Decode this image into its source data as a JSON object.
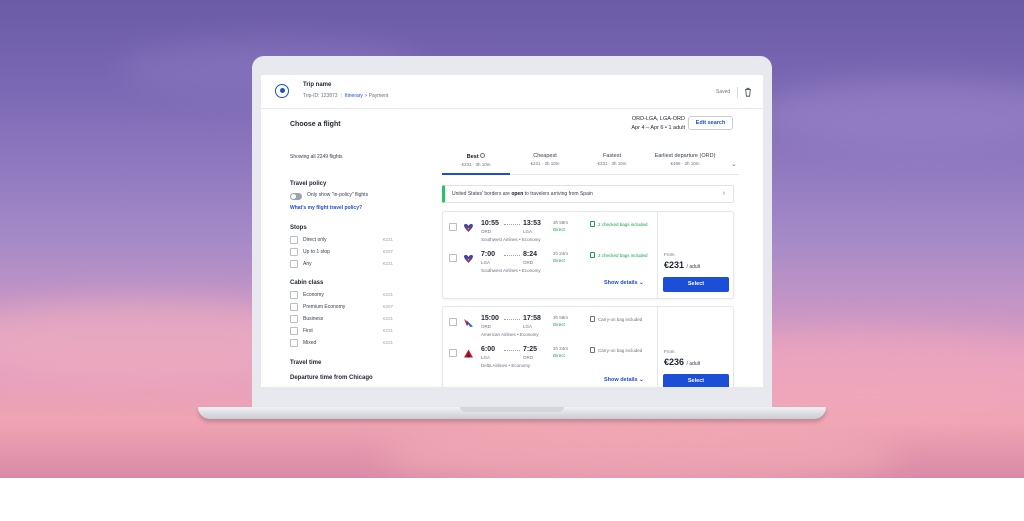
{
  "header": {
    "trip_name": "Trip name",
    "trip_id": "Trip-ID: 123873",
    "breadcrumb_itinerary": "Itinerary",
    "breadcrumb_sep": ">",
    "breadcrumb_payment": "Payment",
    "saved": "Saved"
  },
  "search": {
    "title": "Choose a flight",
    "route": "ORD-LGA, LGA-ORD",
    "dates": "Apr 4 – Apr 6 • 1 adult",
    "edit_label": "Edit search",
    "showing": "Showing all 2249 flights"
  },
  "tabs": [
    {
      "label": "Best",
      "sub": "€231 · 3h 10m"
    },
    {
      "label": "Cheapest",
      "sub": "€231 · 3h 10m"
    },
    {
      "label": "Fastest",
      "sub": "€231 · 3h 10m"
    },
    {
      "label": "Earliest departure (ORD)",
      "sub": "€496 · 3h 10m"
    }
  ],
  "notice": {
    "prefix": "United States' borders are ",
    "bold": "open",
    "suffix": " to travelers arriving from Spain"
  },
  "sidebar": {
    "policy_title": "Travel policy",
    "policy_toggle": "Only show \"in-policy\" flights",
    "policy_link": "What's my flight travel policy?",
    "stops_title": "Stops",
    "stops": [
      {
        "label": "Direct only",
        "price": "€231"
      },
      {
        "label": "Up to 1 stop",
        "price": "€207"
      },
      {
        "label": "Any",
        "price": "€231"
      }
    ],
    "cabin_title": "Cabin class",
    "cabin": [
      {
        "label": "Economy",
        "price": "€231"
      },
      {
        "label": "Premium Economy",
        "price": "€207"
      },
      {
        "label": "Business",
        "price": "€231"
      },
      {
        "label": "First",
        "price": "€231"
      },
      {
        "label": "Mixed",
        "price": "€231"
      }
    ],
    "travel_time_title": "Travel time",
    "departure_title": "Departure time from Chicago"
  },
  "results": [
    {
      "legs": [
        {
          "dep": "10:55",
          "dep_ap": "ORD",
          "arr": "13:53",
          "arr_ap": "LGA",
          "dur": "3h 58m",
          "stops": "Direct",
          "bag": "2 checked bags included",
          "carrier": "Southwest Airlines • Economy"
        },
        {
          "dep": "7:00",
          "dep_ap": "LGA",
          "arr": "8:24",
          "arr_ap": "ORD",
          "dur": "2h 24m",
          "stops": "Direct",
          "bag": "2 checked bags included",
          "carrier": "Southwest Airlines • Economy"
        }
      ],
      "from": "From",
      "price": "€231",
      "per": "/ adult",
      "details": "Show details",
      "select": "Select"
    },
    {
      "legs": [
        {
          "dep": "15:00",
          "dep_ap": "ORD",
          "arr": "17:58",
          "arr_ap": "LGA",
          "dur": "3h 58m",
          "stops": "Direct",
          "bag": "Carry-on bag included",
          "carrier": "American Airlines • Economy"
        },
        {
          "dep": "6:00",
          "dep_ap": "LGA",
          "arr": "7:25",
          "arr_ap": "ORD",
          "dur": "2h 24m",
          "stops": "Direct",
          "bag": "Carry-on bag included",
          "carrier": "Delta Airlines • Economy"
        }
      ],
      "from": "From",
      "price": "€236",
      "per": "/ adult",
      "details": "Show details",
      "select": "Select"
    }
  ],
  "colors": {
    "accent": "#1d4ed8",
    "positive": "#16a34a",
    "southwest_blue": "#304cb2",
    "southwest_red": "#e31837",
    "southwest_yellow": "#f9b612",
    "american_red": "#c8102e",
    "american_blue": "#0078d2",
    "delta_red": "#c01933"
  },
  "icons": [
    "compass-logo-icon",
    "trash-icon",
    "info-icon",
    "chevron-down-icon",
    "chevron-right-icon",
    "bag-icon",
    "southwest-logo-icon",
    "american-logo-icon",
    "delta-logo-icon"
  ]
}
